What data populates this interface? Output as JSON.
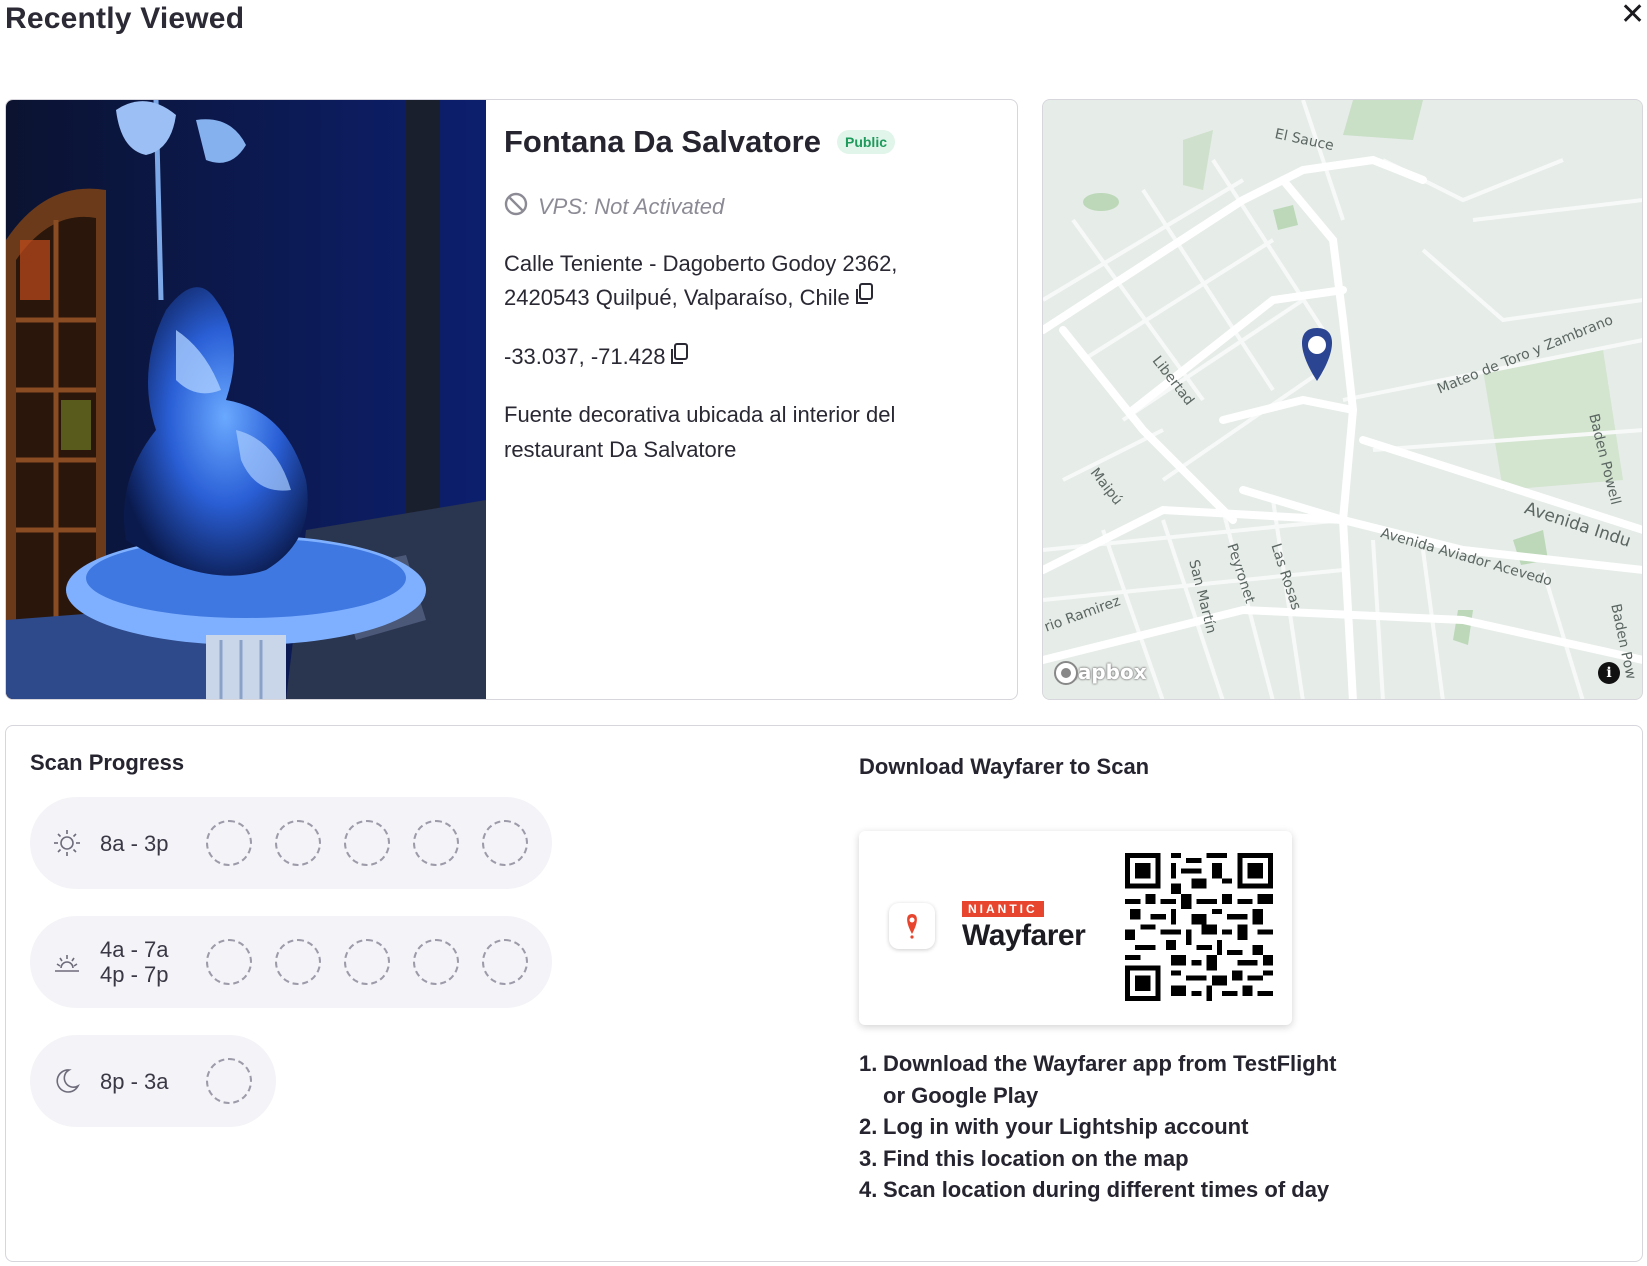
{
  "header": {
    "title": "Recently Viewed",
    "close_icon": "close-icon"
  },
  "poi": {
    "name": "Fontana Da Salvatore",
    "visibility": "Public",
    "vps_status": "VPS: Not Activated",
    "address_line1": "Calle Teniente - Dagoberto Godoy 2362,",
    "address_line2": "2420543 Quilpué, Valparaíso, Chile",
    "coordinates": "-33.037, -71.428",
    "description": "Fuente decorativa ubicada al interior del restaurant Da Salvatore"
  },
  "map": {
    "streets": [
      "El Sauce",
      "Libertad",
      "Mateo de Toro y Zambrano",
      "Baden Powell",
      "Avenida Indu",
      "Avenida Aviador Acevedo",
      "Maipú",
      "San Martín",
      "Peyronet",
      "Las Rosas",
      "rio Ramirez",
      "Baden Pow"
    ],
    "attribution": "mapbox",
    "info_label": "i",
    "marker_color": "#2b4593"
  },
  "scan_progress": {
    "title": "Scan Progress",
    "slots": [
      {
        "icon": "sun-icon",
        "label_lines": [
          "8a - 3p"
        ],
        "scans_required": 5,
        "scans_done": 0
      },
      {
        "icon": "sunrise-icon",
        "label_lines": [
          "4a - 7a",
          "4p - 7p"
        ],
        "scans_required": 5,
        "scans_done": 0
      },
      {
        "icon": "moon-icon",
        "label_lines": [
          "8p - 3a"
        ],
        "scans_required": 1,
        "scans_done": 0
      }
    ]
  },
  "download": {
    "title": "Download Wayfarer to Scan",
    "brand_small": "NIANTIC",
    "brand_name": "Wayfarer",
    "steps": [
      "Download the Wayfarer app from TestFlight or Google Play",
      "Log in with your Lightship account",
      "Find this location on the map",
      "Scan location during different times of day"
    ]
  },
  "colors": {
    "badge_bg": "#e1f5ea",
    "badge_text": "#1e9a5c",
    "pill_bg": "#f4f3f7",
    "niantic_red": "#e8452e"
  }
}
